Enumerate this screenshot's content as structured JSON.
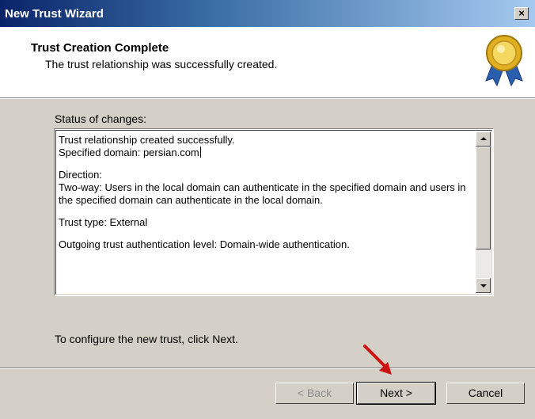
{
  "window": {
    "title": "New Trust Wizard",
    "close_label": "×"
  },
  "header": {
    "title": "Trust Creation Complete",
    "subtitle": "The trust relationship was successfully created.",
    "icon": "certificate-ribbon-icon"
  },
  "status": {
    "label": "Status of changes:",
    "lines": [
      "Trust relationship created successfully.",
      "Specified domain: persian.com",
      "Direction:",
      "Two-way: Users in the local domain can authenticate in the specified domain and users in the specified domain can authenticate in the local domain.",
      "Trust type: External",
      "Outgoing trust authentication level: Domain-wide authentication."
    ]
  },
  "instruction": "To configure the new trust, click Next.",
  "buttons": {
    "back": "< Back",
    "next": "Next >",
    "cancel": "Cancel"
  },
  "colors": {
    "title_bar": "#0a246a",
    "dialog_bg": "#d4d0c8",
    "annotation_arrow": "#cc1111"
  }
}
